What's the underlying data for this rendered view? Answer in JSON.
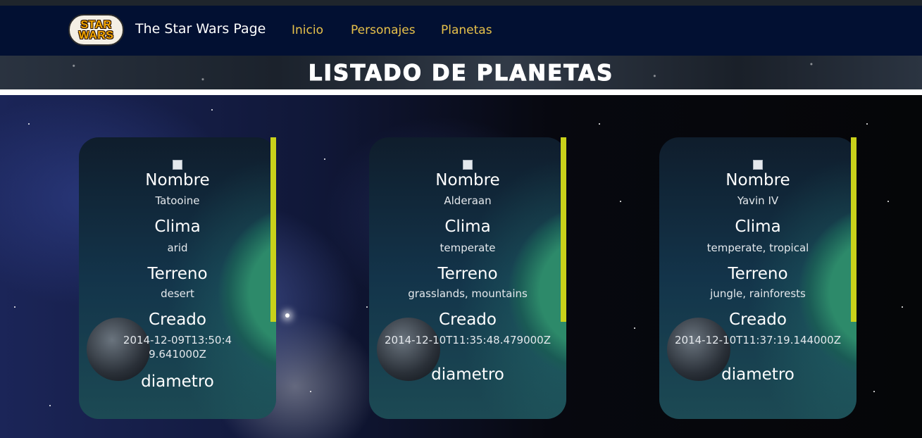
{
  "navbar": {
    "logo_lines": [
      "STAR",
      "WARS"
    ],
    "brand": "The Star Wars Page",
    "links": [
      "Inicio",
      "Personajes",
      "Planetas"
    ]
  },
  "banner": {
    "title": "LISTADO DE PLANETAS"
  },
  "labels": {
    "name": "Nombre",
    "climate": "Clima",
    "terrain": "Terreno",
    "created": "Creado",
    "diameter": "diametro"
  },
  "planets": [
    {
      "name": "Tatooine",
      "climate": "arid",
      "terrain": "desert",
      "created": "2014-12-09T13:50:49.641000Z"
    },
    {
      "name": "Alderaan",
      "climate": "temperate",
      "terrain": "grasslands, mountains",
      "created": "2014-12-10T11:35:48.479000Z"
    },
    {
      "name": "Yavin IV",
      "climate": "temperate, tropical",
      "terrain": "jungle, rainforests",
      "created": "2014-12-10T11:37:19.144000Z"
    }
  ],
  "colors": {
    "navbar_bg": "#021032",
    "nav_link": "#e8c24a",
    "scrollbar": "#c9d11a"
  }
}
